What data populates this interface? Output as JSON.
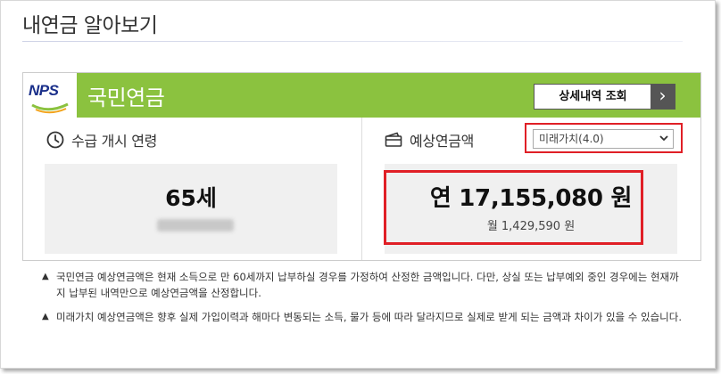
{
  "page": {
    "title": "내연금 알아보기"
  },
  "card": {
    "logo_text": "NPS",
    "title": "국민연금",
    "detail_button": "상세내역 조회",
    "detail_arrow": "›"
  },
  "left": {
    "label": "수급 개시 연령",
    "age": "65세"
  },
  "right": {
    "label": "예상연금액",
    "select_value": "미래가치(4.0)",
    "yearly": "연 17,155,080 원",
    "monthly": "월 1,429,590 원"
  },
  "notes": [
    {
      "bullet": "▲",
      "text": "국민연금 예상연금액은 현재 소득으로 만 60세까지 납부하실 경우를 가정하여 산정한 금액입니다. 다만, 상실 또는 납부예외 중인 경우에는 현재까지 납부된 내역만으로 예상연금액을 산정합니다."
    },
    {
      "bullet": "▲",
      "text": "미래가치 예상연금액은 향후 실제 가입이력과 해마다 변동되는 소득, 물가 등에 따라 달라지므로 실제로 받게 되는 금액과 차이가 있을 수 있습니다."
    }
  ],
  "colors": {
    "brand_green": "#8bc23f",
    "highlight_red": "#e01f26",
    "logo_blue": "#1a2f8a"
  },
  "icons": {
    "age": "clock-icon",
    "amount": "wallet-icon",
    "select": "chevron-down-icon",
    "button": "chevron-right-icon"
  }
}
